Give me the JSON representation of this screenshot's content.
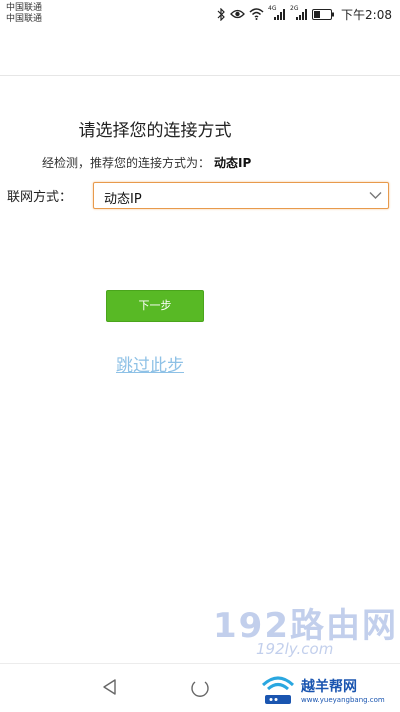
{
  "status_bar": {
    "carrier_1": "中国联通",
    "carrier_2": "中国联通",
    "signal_label_1": "4G",
    "signal_label_2": "2G",
    "time": "下午2:08"
  },
  "page": {
    "title": "请选择您的连接方式",
    "detect_prefix": "经检测，推荐您的连接方式为：",
    "detect_value": "动态IP"
  },
  "form": {
    "label": "联网方式：",
    "selected": "动态IP"
  },
  "actions": {
    "next_label": "下一步",
    "skip_label": "跳过此步"
  },
  "watermark": {
    "line_1": "192路由网",
    "line_2": "192ly.com"
  },
  "logo": {
    "text": "越羊帮网",
    "url": "www.yueyangbang.com"
  },
  "colors": {
    "accent_green": "#58b925",
    "link_blue": "#8ec1e6",
    "select_border": "#e89a4c"
  },
  "icons": [
    "bluetooth-icon",
    "eye-icon",
    "wifi-icon",
    "signal-icon",
    "battery-icon",
    "chevron-down-icon",
    "nav-back-icon",
    "nav-home-icon"
  ]
}
